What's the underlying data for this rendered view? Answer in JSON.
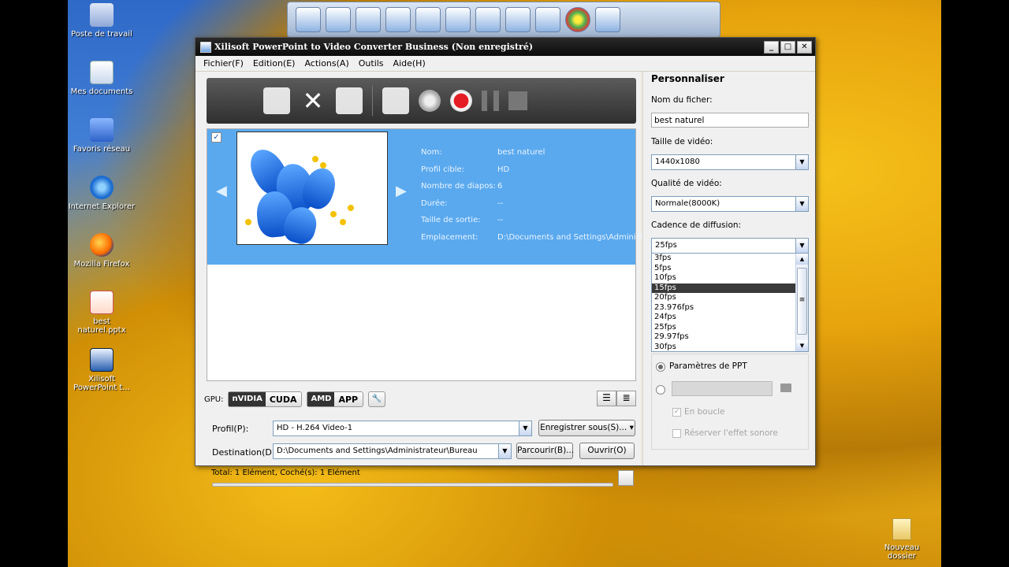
{
  "desktop": {
    "icons": [
      {
        "label": "Poste de travail",
        "icon": "my-computer-icon"
      },
      {
        "label": "Mes documents",
        "icon": "my-documents-icon"
      },
      {
        "label": "Favoris réseau",
        "icon": "network-places-icon"
      },
      {
        "label": "Internet Explorer",
        "icon": "internet-explorer-icon"
      },
      {
        "label": "Mozilla Firefox",
        "icon": "firefox-icon"
      },
      {
        "label": "best naturel.pptx",
        "icon": "powerpoint-file-icon"
      },
      {
        "label": "Xilisoft PowerPoint t...",
        "icon": "xilisoft-icon"
      }
    ],
    "folder_label": "Nouveau dossier"
  },
  "window": {
    "title": "Xilisoft PowerPoint to Video Converter Business (Non enregistré)",
    "buttons": [
      "_",
      "□",
      "✕"
    ]
  },
  "menu": [
    "Fichier(F)",
    "Edition(E)",
    "Actions(A)",
    "Outils",
    "Aide(H)"
  ],
  "file": {
    "checked": true,
    "fields": [
      {
        "key": "Nom:",
        "value": "best naturel"
      },
      {
        "key": "Profil cible:",
        "value": "HD"
      },
      {
        "key": "Nombre de diapos:",
        "value": "6"
      },
      {
        "key": "Durée:",
        "value": "--"
      },
      {
        "key": "Taille de sortie:",
        "value": "--"
      },
      {
        "key": "Emplacement:",
        "value": "D:\\Documents and Settings\\Administra"
      }
    ]
  },
  "gpu": {
    "label": "GPU:",
    "cuda_logo": "nVIDIA",
    "cuda": "CUDA",
    "amd_logo": "AMD",
    "amd": "APP"
  },
  "profile": {
    "label": "Profil(P):",
    "value": "HD - H.264 Video-1",
    "save_as": "Enregistrer sous(S)..."
  },
  "destination": {
    "label": "Destination(D):",
    "value": "D:\\Documents and Settings\\Administrateur\\Bureau",
    "browse": "Parcourir(B)...",
    "open": "Ouvrir(O)"
  },
  "status": "Total: 1 Elément, Coché(s): 1 Elément",
  "panel": {
    "title": "Personnaliser",
    "filename_label": "Nom du ficher:",
    "filename_value": "best naturel",
    "video_size_label": "Taille de vidéo:",
    "video_size_value": "1440x1080",
    "quality_label": "Qualité de vidéo:",
    "quality_value": "Normale(8000K)",
    "framerate_label": "Cadence de diffusion:",
    "framerate_value": "25fps",
    "framerate_options": [
      "3fps",
      "5fps",
      "10fps",
      "15fps",
      "20fps",
      "23.976fps",
      "24fps",
      "25fps",
      "29.97fps",
      "30fps"
    ],
    "framerate_highlighted": "15fps",
    "ppt_params": "Paramètres de PPT",
    "loop": "En boucle",
    "keep_sound": "Réserver l'effet sonore"
  }
}
